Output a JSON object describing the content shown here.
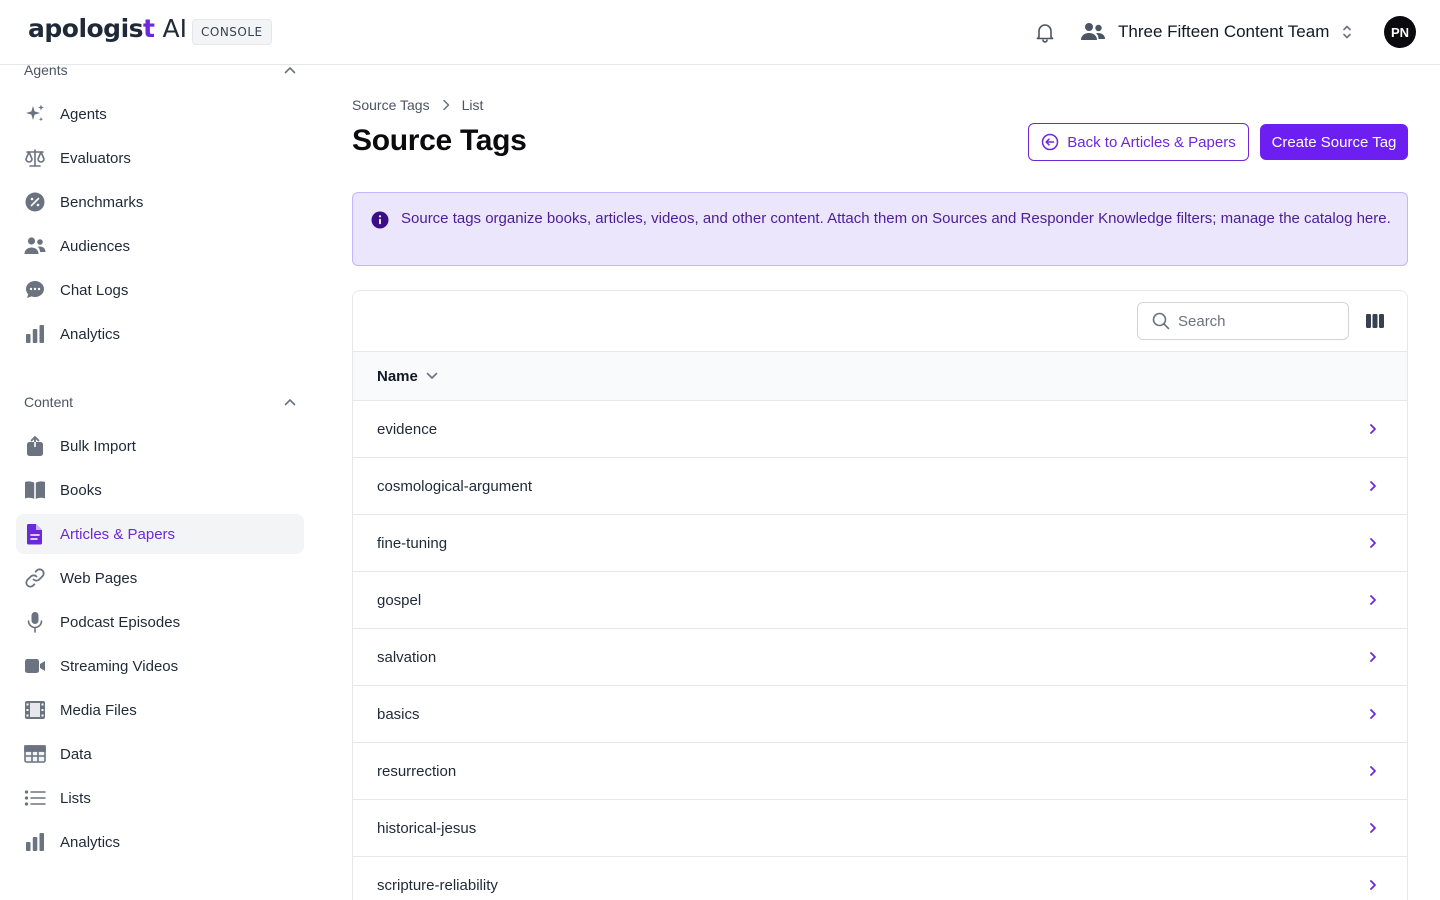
{
  "header": {
    "logo_word": "apologis",
    "logo_cross": "t",
    "logo_ai": "AI",
    "console_badge": "CONSOLE",
    "team_name": "Three Fifteen Content Team",
    "avatar_initials": "PN"
  },
  "sidebar": {
    "agents_section": {
      "label": "Agents"
    },
    "agents_items": [
      {
        "label": "Agents",
        "icon": "sparkles-icon"
      },
      {
        "label": "Evaluators",
        "icon": "scale-icon"
      },
      {
        "label": "Benchmarks",
        "icon": "percent-badge-icon"
      },
      {
        "label": "Audiences",
        "icon": "users-icon"
      },
      {
        "label": "Chat Logs",
        "icon": "chat-bubble-icon"
      },
      {
        "label": "Analytics",
        "icon": "bar-chart-icon"
      }
    ],
    "content_section": {
      "label": "Content"
    },
    "content_items": [
      {
        "label": "Bulk Import",
        "icon": "upload-stack-icon"
      },
      {
        "label": "Books",
        "icon": "book-icon"
      },
      {
        "label": "Articles & Papers",
        "icon": "document-icon",
        "active": true
      },
      {
        "label": "Web Pages",
        "icon": "link-icon"
      },
      {
        "label": "Podcast Episodes",
        "icon": "microphone-icon"
      },
      {
        "label": "Streaming Videos",
        "icon": "video-camera-icon"
      },
      {
        "label": "Media Files",
        "icon": "film-icon"
      },
      {
        "label": "Data",
        "icon": "table-icon"
      },
      {
        "label": "Lists",
        "icon": "list-icon"
      },
      {
        "label": "Analytics",
        "icon": "bar-chart-icon"
      }
    ]
  },
  "main": {
    "breadcrumb": {
      "root": "Source Tags",
      "current": "List"
    },
    "title": "Source Tags",
    "back_button": "Back to Articles & Papers",
    "create_button": "Create Source Tag",
    "info_text": "Source tags organize books, articles, videos, and other content. Attach them on Sources and Responder Knowledge filters; manage the catalog here.",
    "search": {
      "placeholder": "Search",
      "value": ""
    },
    "table": {
      "column_name": "Name",
      "rows": [
        "evidence",
        "cosmological-argument",
        "fine-tuning",
        "gospel",
        "salvation",
        "basics",
        "resurrection",
        "historical-jesus",
        "scripture-reliability"
      ]
    }
  },
  "colors": {
    "accent": "#6d28d9",
    "primary_button": "#6d1ef0",
    "info_bg": "#ebe6fc"
  }
}
